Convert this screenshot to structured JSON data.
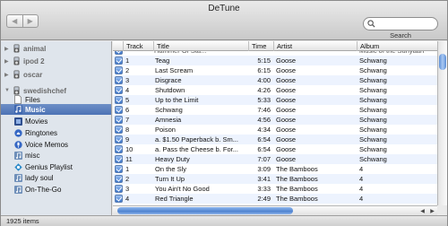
{
  "window": {
    "title": "DeTune"
  },
  "nav": {
    "back": "◀",
    "forward": "▶"
  },
  "search": {
    "label": "Search",
    "value": "",
    "placeholder": ""
  },
  "sidebar": {
    "devices": [
      {
        "label": "animal",
        "icon": "ipod-icon"
      },
      {
        "label": "ipod 2",
        "icon": "ipod-icon"
      },
      {
        "label": "oscar",
        "icon": "ipod-icon"
      },
      {
        "label": "swedishchef",
        "icon": "ipod-icon"
      }
    ],
    "items": [
      {
        "label": "Files",
        "icon": "document-icon"
      },
      {
        "label": "Music",
        "icon": "music-note-icon",
        "selected": true
      },
      {
        "label": "Movies",
        "icon": "film-icon"
      },
      {
        "label": "Ringtones",
        "icon": "bell-icon"
      },
      {
        "label": "Voice Memos",
        "icon": "microphone-icon"
      },
      {
        "label": "misc",
        "icon": "playlist-icon"
      },
      {
        "label": "Genius Playlist",
        "icon": "genius-icon"
      },
      {
        "label": "lady soul",
        "icon": "playlist-icon"
      },
      {
        "label": "On-The-Go",
        "icon": "playlist-icon"
      }
    ]
  },
  "table": {
    "columns": [
      "Track",
      "Title",
      "Time",
      "Artist",
      "Album"
    ],
    "partial_row": {
      "track": "",
      "title": "Hammer Of Sta...",
      "time": "",
      "artist": "",
      "album": "Music of the Sunyaari"
    },
    "rows": [
      {
        "track": "1",
        "title": "Teag",
        "time": "5:15",
        "artist": "Goose",
        "album": "Schwang"
      },
      {
        "track": "2",
        "title": "Last Scream",
        "time": "6:15",
        "artist": "Goose",
        "album": "Schwang"
      },
      {
        "track": "3",
        "title": "Disgrace",
        "time": "4:00",
        "artist": "Goose",
        "album": "Schwang"
      },
      {
        "track": "4",
        "title": "Shutdown",
        "time": "4:26",
        "artist": "Goose",
        "album": "Schwang"
      },
      {
        "track": "5",
        "title": "Up to the Limit",
        "time": "5:33",
        "artist": "Goose",
        "album": "Schwang"
      },
      {
        "track": "6",
        "title": "Schwang",
        "time": "7:46",
        "artist": "Goose",
        "album": "Schwang"
      },
      {
        "track": "7",
        "title": "Amnesia",
        "time": "4:56",
        "artist": "Goose",
        "album": "Schwang"
      },
      {
        "track": "8",
        "title": "Poison",
        "time": "4:34",
        "artist": "Goose",
        "album": "Schwang"
      },
      {
        "track": "9",
        "title": "a. $1.50 Paperback b. Sm...",
        "time": "6:54",
        "artist": "Goose",
        "album": "Schwang"
      },
      {
        "track": "10",
        "title": "a. Pass the Cheese b. For...",
        "time": "6:54",
        "artist": "Goose",
        "album": "Schwang"
      },
      {
        "track": "11",
        "title": "Heavy Duty",
        "time": "7:07",
        "artist": "Goose",
        "album": "Schwang"
      },
      {
        "track": "1",
        "title": "On the Sly",
        "time": "3:09",
        "artist": "The Bamboos",
        "album": "4"
      },
      {
        "track": "2",
        "title": "Turn It Up",
        "time": "3:41",
        "artist": "The Bamboos",
        "album": "4"
      },
      {
        "track": "3",
        "title": "You Ain't No Good",
        "time": "3:33",
        "artist": "The Bamboos",
        "album": "4"
      },
      {
        "track": "4",
        "title": "Red Triangle",
        "time": "2:49",
        "artist": "The Bamboos",
        "album": "4"
      }
    ]
  },
  "status": {
    "count": "1925 items"
  },
  "colors": {
    "selection": "#4c72b5",
    "row_alt": "#edf3fe",
    "sidebar_bg": "#dfe5ec"
  }
}
